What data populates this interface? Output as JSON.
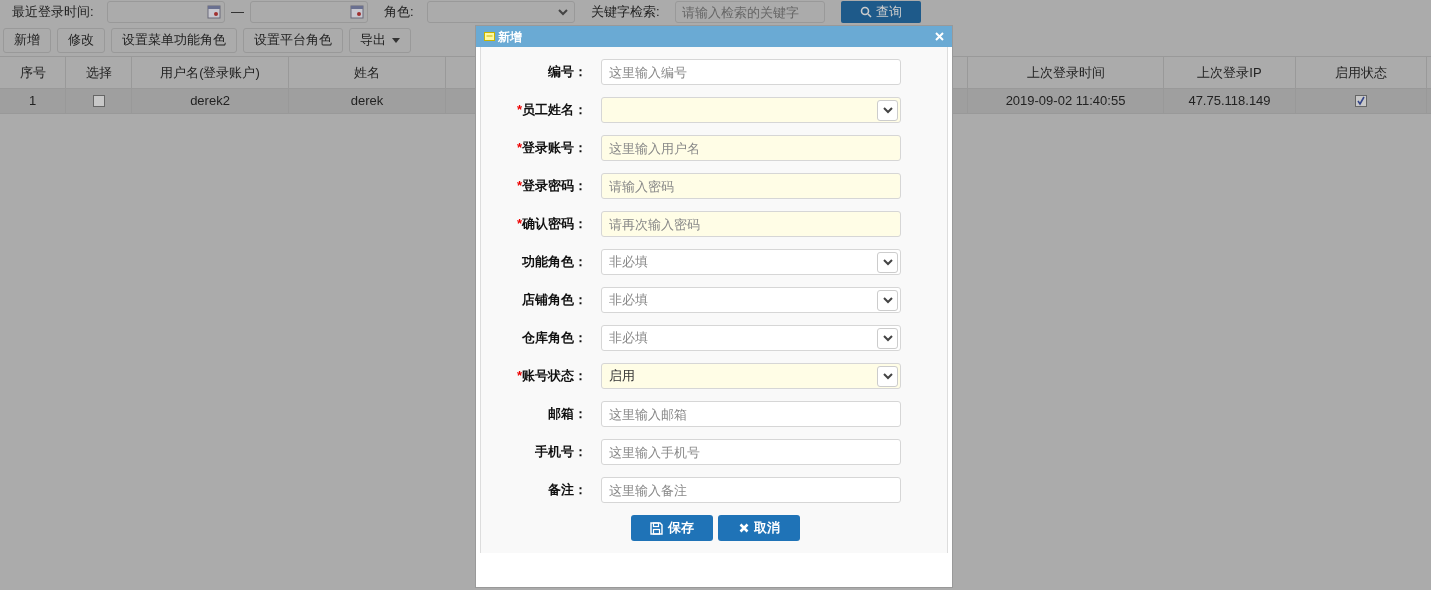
{
  "filter_bar": {
    "date_label": "最近登录时间:",
    "date_separator": "—",
    "role_label": "角色:",
    "keyword_label": "关键字检索:",
    "keyword_placeholder": "请输入检索的关键字",
    "search_button": "查询"
  },
  "toolbar": [
    {
      "label": "新增",
      "kind": "button"
    },
    {
      "label": "修改",
      "kind": "button"
    },
    {
      "label": "设置菜单功能角色",
      "kind": "button"
    },
    {
      "label": "设置平台角色",
      "kind": "button"
    },
    {
      "label": "导出",
      "kind": "dropdown"
    }
  ],
  "table": {
    "columns": [
      "序号",
      "选择",
      "用户名(登录账户)",
      "姓名",
      "上次登录时间",
      "上次登录IP",
      "启用状态"
    ],
    "rows": [
      {
        "index": "1",
        "selected": false,
        "username": "derek2",
        "name": "derek",
        "last_login_time": "2019-09-02 11:40:55",
        "last_login_ip": "47.75.118.149",
        "enabled": true
      }
    ]
  },
  "dialog": {
    "title": "新增",
    "fields": [
      {
        "label": "编号",
        "required": false,
        "kind": "input",
        "placeholder": "这里输入编号"
      },
      {
        "label": "员工姓名",
        "required": true,
        "kind": "select"
      },
      {
        "label": "登录账号",
        "required": true,
        "kind": "input",
        "placeholder": "这里输入用户名"
      },
      {
        "label": "登录密码",
        "required": true,
        "kind": "input",
        "placeholder": "请输入密码"
      },
      {
        "label": "确认密码",
        "required": true,
        "kind": "input",
        "placeholder": "请再次输入密码"
      },
      {
        "label": "功能角色",
        "required": false,
        "kind": "select",
        "placeholder": "非必填"
      },
      {
        "label": "店铺角色",
        "required": false,
        "kind": "select",
        "placeholder": "非必填"
      },
      {
        "label": "仓库角色",
        "required": false,
        "kind": "select",
        "placeholder": "非必填"
      },
      {
        "label": "账号状态",
        "required": true,
        "kind": "select",
        "value": "启用"
      },
      {
        "label": "邮箱",
        "required": false,
        "kind": "input",
        "placeholder": "这里输入邮箱"
      },
      {
        "label": "手机号",
        "required": false,
        "kind": "input",
        "placeholder": "这里输入手机号"
      },
      {
        "label": "备注",
        "required": false,
        "kind": "input",
        "placeholder": "这里输入备注"
      }
    ],
    "buttons": [
      {
        "label": "保存",
        "kind": "save"
      },
      {
        "label": "取消",
        "kind": "cancel"
      }
    ],
    "required_mark": "*",
    "label_suffix": "："
  }
}
